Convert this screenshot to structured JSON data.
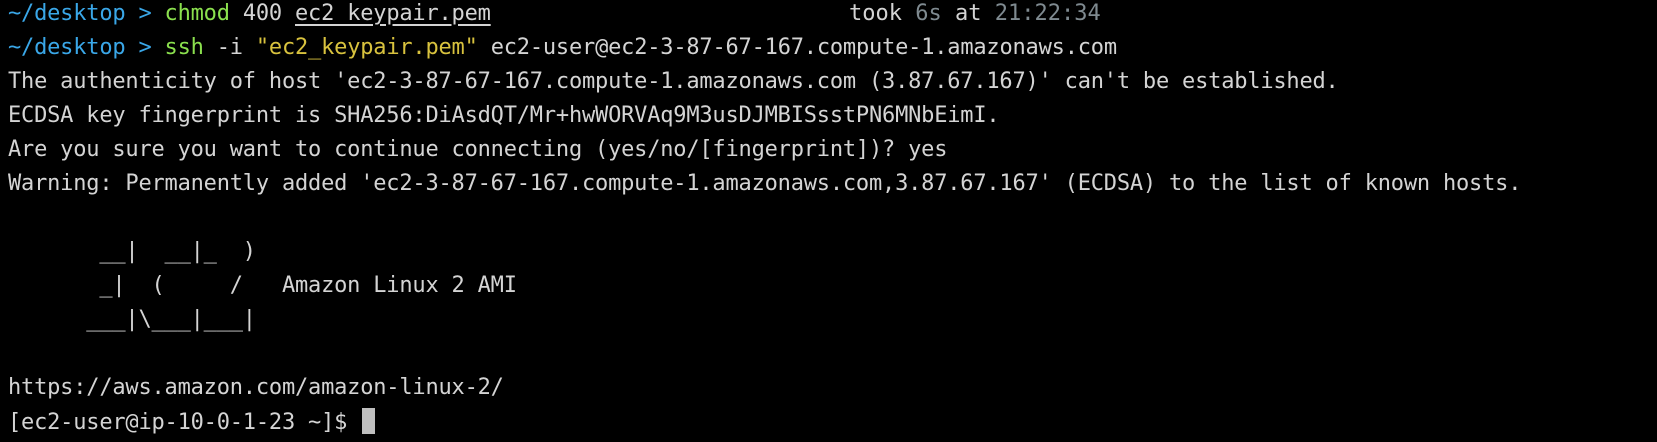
{
  "colors": {
    "background": "#000000",
    "text": "#d4d4d4",
    "path": "#3aa7e8",
    "command": "#8be04e",
    "string": "#d8c23e",
    "dim": "#7f8a90"
  },
  "line1": {
    "path": "~/desktop",
    "chevron": ">",
    "command": "chmod",
    "args": "400",
    "file": "ec2_keypair.pem",
    "took_label": "took",
    "took_value": "6s",
    "at_label": "at",
    "time": "21:22:34"
  },
  "line2": {
    "path": "~/desktop",
    "chevron": ">",
    "command": "ssh",
    "flag": "-i",
    "key_arg": "\"ec2_keypair.pem\"",
    "host": "ec2-user@ec2-3-87-67-167.compute-1.amazonaws.com"
  },
  "output": [
    "The authenticity of host 'ec2-3-87-67-167.compute-1.amazonaws.com (3.87.67.167)' can't be established.",
    "ECDSA key fingerprint is SHA256:DiAsdQT/Mr+hwWORVAq9M3usDJMBISsstPN6MNbEimI.",
    "Are you sure you want to continue connecting (yes/no/[fingerprint])? yes",
    "Warning: Permanently added 'ec2-3-87-67-167.compute-1.amazonaws.com,3.87.67.167' (ECDSA) to the list of known hosts."
  ],
  "banner": [
    "       __|  __|_  )",
    "       _|  (     /   Amazon Linux 2 AMI",
    "      ___|\\___|___|"
  ],
  "url": "https://aws.amazon.com/amazon-linux-2/",
  "prompt": "[ec2-user@ip-10-0-1-23 ~]$ "
}
